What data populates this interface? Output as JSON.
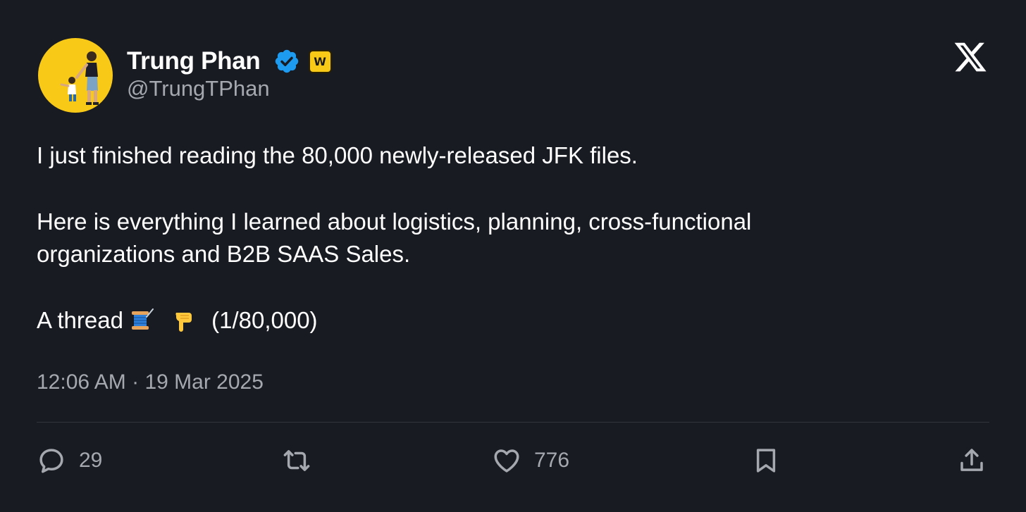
{
  "author": {
    "display_name": "Trung Phan",
    "handle": "@TrungTPhan",
    "verified_icon": "verified-badge-icon",
    "affiliate_badge_letter": "W",
    "avatar_bg": "#f8c916"
  },
  "platform_icon": "x-logo-icon",
  "tweet": {
    "line1": "I just finished reading the 80,000 newly-released JFK files.",
    "line2a": "Here is everything I learned about logistics, planning, cross-functional",
    "line2b": "organizations and B2B SAAS Sales.",
    "line3_prefix": "A thread ",
    "line3_suffix": "(1/80,000)",
    "emojis": [
      "thread-spool-emoji",
      "pointing-down-emoji"
    ]
  },
  "meta": {
    "time": "12:06 AM",
    "separator": " · ",
    "date": "19 Mar 2025"
  },
  "actions": {
    "reply_count": "29",
    "like_count": "776"
  },
  "colors": {
    "background": "#191b23",
    "text": "#ffffff",
    "muted": "#a6a8b0",
    "verified": "#1d9bf0",
    "divider": "#33353d"
  }
}
